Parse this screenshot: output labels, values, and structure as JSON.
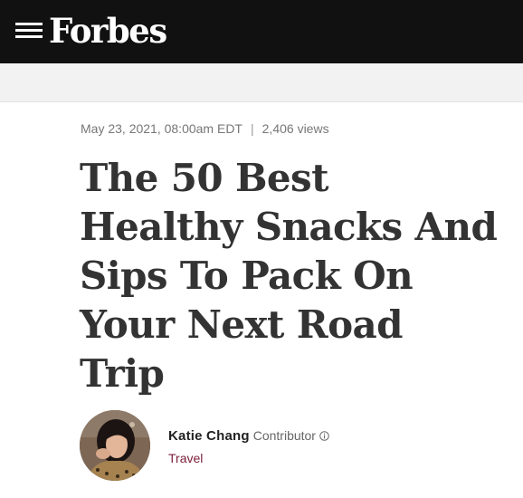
{
  "brand": {
    "logo_text": "Forbes"
  },
  "article": {
    "date": "May 23, 2021, 08:00am EDT",
    "separator": "|",
    "views": "2,406 views",
    "headline_lines": [
      "The 50 Best",
      "Healthy Snacks And",
      "Sips To Pack On",
      "Your Next Road",
      "Trip"
    ]
  },
  "author": {
    "name": "Katie Chang",
    "role": "Contributor",
    "category": "Travel"
  },
  "colors": {
    "topbar": "#111111",
    "subbar": "#f2f2f2",
    "headline": "#333333",
    "meta": "#777777",
    "category": "#7b1e3a"
  },
  "icons": {
    "menu": "hamburger-menu-icon",
    "info": "info-icon"
  }
}
